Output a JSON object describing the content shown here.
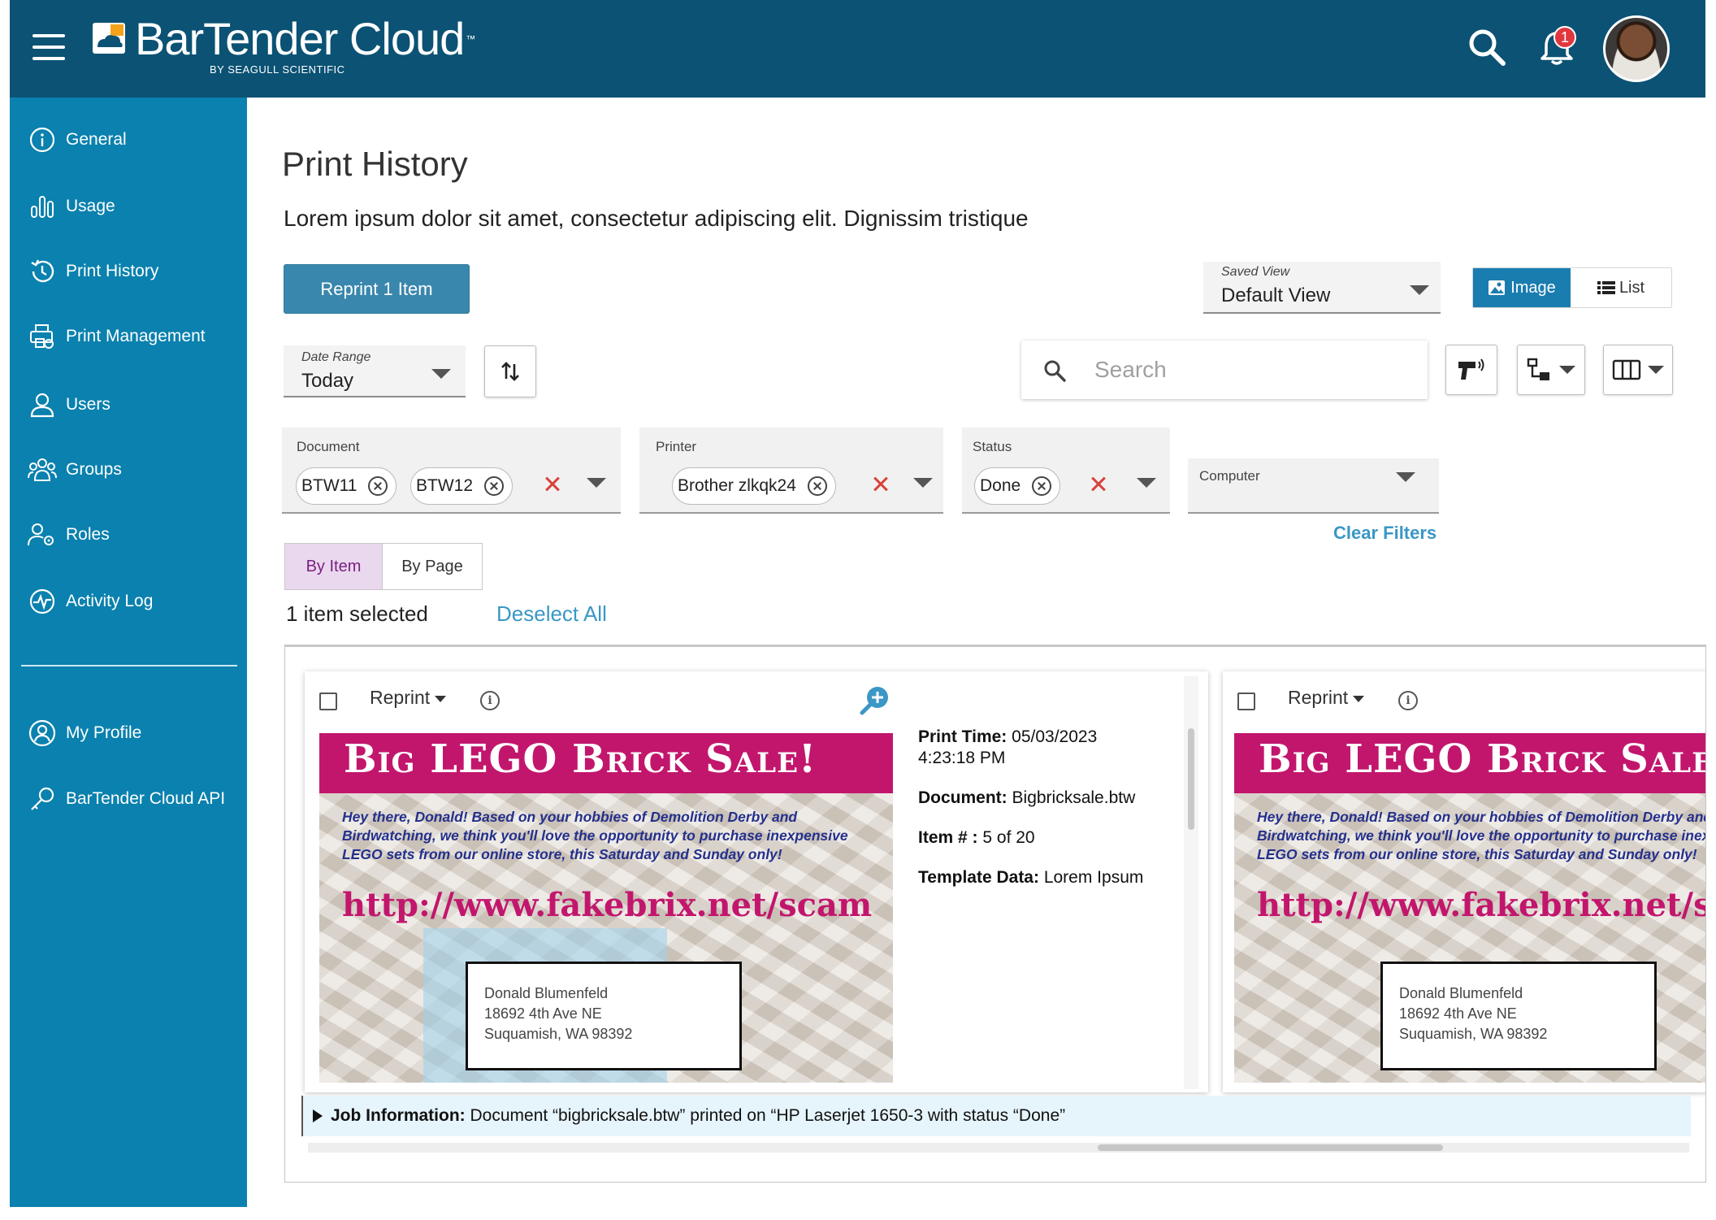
{
  "header": {
    "brand": "BarTender Cloud",
    "brand_tm": "™",
    "brand_sub": "BY SEAGULL SCIENTIFIC",
    "notification_count": "1"
  },
  "sidebar": {
    "items": [
      {
        "label": "General",
        "icon": "info-circle-icon"
      },
      {
        "label": "Usage",
        "icon": "bar-chart-icon"
      },
      {
        "label": "Print History",
        "icon": "history-icon"
      },
      {
        "label": "Print Management",
        "icon": "printer-gear-icon"
      },
      {
        "label": "Users",
        "icon": "user-icon"
      },
      {
        "label": "Groups",
        "icon": "group-icon"
      },
      {
        "label": "Roles",
        "icon": "user-gear-icon"
      },
      {
        "label": "Activity Log",
        "icon": "activity-icon"
      }
    ],
    "bottom_items": [
      {
        "label": "My Profile",
        "icon": "profile-icon"
      },
      {
        "label": "BarTender Cloud API",
        "icon": "key-icon"
      }
    ]
  },
  "main": {
    "title": "Print History",
    "subtitle": "Lorem ipsum dolor sit amet, consectetur adipiscing elit. Dignissim tristique",
    "reprint_button": "Reprint 1 Item",
    "saved_view": {
      "label": "Saved View",
      "value": "Default View"
    },
    "view_toggle": {
      "image": "Image",
      "list": "List",
      "selected": "Image"
    },
    "date_range": {
      "label": "Date Range",
      "value": "Today"
    },
    "search": {
      "placeholder": "Search",
      "value": ""
    },
    "filters": {
      "document": {
        "label": "Document",
        "chips": [
          "BTW11",
          "BTW12"
        ]
      },
      "printer": {
        "label": "Printer",
        "chips": [
          "Brother zlkqk24"
        ]
      },
      "status": {
        "label": "Status",
        "chips": [
          "Done"
        ]
      },
      "computer": {
        "label": "Computer",
        "chips": []
      }
    },
    "clear_filters": "Clear Filters",
    "tabs": {
      "by_item": "By Item",
      "by_page": "By Page",
      "selected": "By Item"
    },
    "selection_text": "1 item selected",
    "deselect_all": "Deselect All"
  },
  "cards": [
    {
      "reprint_label": "Reprint",
      "selected": false,
      "label": {
        "banner": "Big LEGO Brick Sale!",
        "body": "Hey there, Donald! Based on your hobbies of Demolition Derby and Birdwatching, we think you'll love the opportunity to purchase inexpensive LEGO sets from our online store, this Saturday and Sunday only!",
        "url": "http://www.fakebrix.net/scam",
        "address": [
          "Donald Blumenfeld",
          "18692 4th Ave NE",
          "Suquamish, WA 98392"
        ]
      },
      "details": {
        "print_time_label": "Print Time:",
        "print_time": "05/03/2023",
        "print_time_2": "4:23:18 PM",
        "document_label": "Document:",
        "document": "Bigbricksale.btw",
        "item_label": "Item # :",
        "item": "5 of 20",
        "template_label": "Template Data:",
        "template": "Lorem Ipsum"
      }
    },
    {
      "reprint_label": "Reprint",
      "selected": false,
      "label": {
        "banner": "Big LEGO Brick Sale!",
        "body": "Hey there, Donald! Based on your hobbies of Demolition Derby and Birdwatching, we think you'll love the opportunity to purchase inexpensive LEGO sets from our online store, this Saturday and Sunday only!",
        "url": "http://www.fakebrix.net/scam",
        "address": [
          "Donald Blumenfeld",
          "18692 4th Ave NE",
          "Suquamish, WA 98392"
        ]
      }
    }
  ],
  "job_info": {
    "label": "Job Information:",
    "text": "Document “bigbricksale.btw” printed on “HP Laserjet 1650-3 with status “Done”"
  },
  "colors": {
    "header_bg": "#0b5274",
    "sidebar_bg": "#0a81ae",
    "primary_button": "#3a87ad",
    "link": "#3a97c6",
    "label_magenta": "#c2166d",
    "label_text_blue": "#24308c",
    "badge_red": "#e0373f",
    "clear_x_red": "#d9413a",
    "tab_selected_bg": "#ead8ee"
  }
}
